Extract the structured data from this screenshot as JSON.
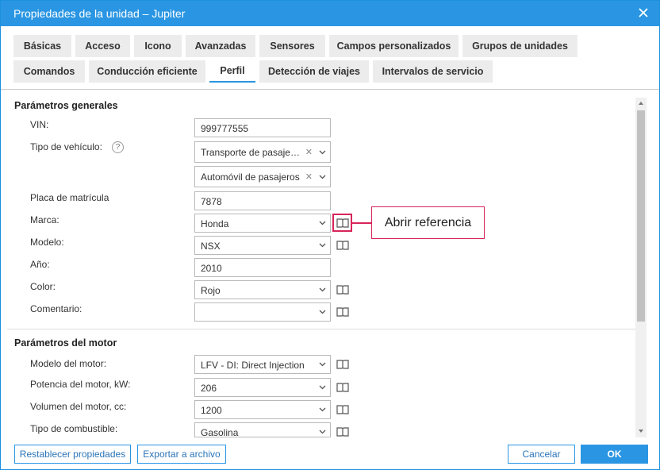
{
  "window": {
    "title": "Propiedades de la unidad – Jupiter"
  },
  "tabs": [
    {
      "label": "Básicas"
    },
    {
      "label": "Acceso"
    },
    {
      "label": "Icono"
    },
    {
      "label": "Avanzadas"
    },
    {
      "label": "Sensores"
    },
    {
      "label": "Campos personalizados"
    },
    {
      "label": "Grupos de unidades"
    },
    {
      "label": "Comandos"
    },
    {
      "label": "Conducción eficiente"
    },
    {
      "label": "Perfil"
    },
    {
      "label": "Detección de viajes"
    },
    {
      "label": "Intervalos de servicio"
    }
  ],
  "general": {
    "title": "Parámetros generales",
    "vin_label": "VIN:",
    "vin_value": "999777555",
    "vehicle_type_label": "Tipo de vehículo:",
    "help": "?",
    "vehicle_type_value": "Transporte de pasajeros",
    "vehicle_subtype_value": "Automóvil de pasajeros",
    "plate_label": "Placa de matrícula",
    "plate_value": "7878",
    "brand_label": "Marca:",
    "brand_value": "Honda",
    "model_label": "Modelo:",
    "model_value": "NSX",
    "year_label": "Año:",
    "year_value": "2010",
    "color_label": "Color:",
    "color_value": "Rojo",
    "comment_label": "Comentario:",
    "comment_value": ""
  },
  "engine": {
    "title": "Parámetros del motor",
    "engine_model_label": "Modelo del motor:",
    "engine_model_value": "LFV - DI: Direct Injection",
    "power_label": "Potencia del motor, kW:",
    "power_value": "206",
    "volume_label": "Volumen del motor, cc:",
    "volume_value": "1200",
    "fuel_label": "Tipo de combustible:",
    "fuel_value": "Gasolina"
  },
  "callout": {
    "text": "Abrir referencia"
  },
  "footer": {
    "reset_label": "Restablecer propiedades",
    "export_label": "Exportar a archivo",
    "cancel_label": "Cancelar",
    "ok_label": "OK"
  },
  "colors": {
    "accent": "#2a96e3",
    "callout": "#d8245a"
  },
  "icons": {
    "close": "close-icon",
    "reference": "book-icon",
    "dropdown": "chevron-down-icon",
    "clear": "clear-icon"
  }
}
